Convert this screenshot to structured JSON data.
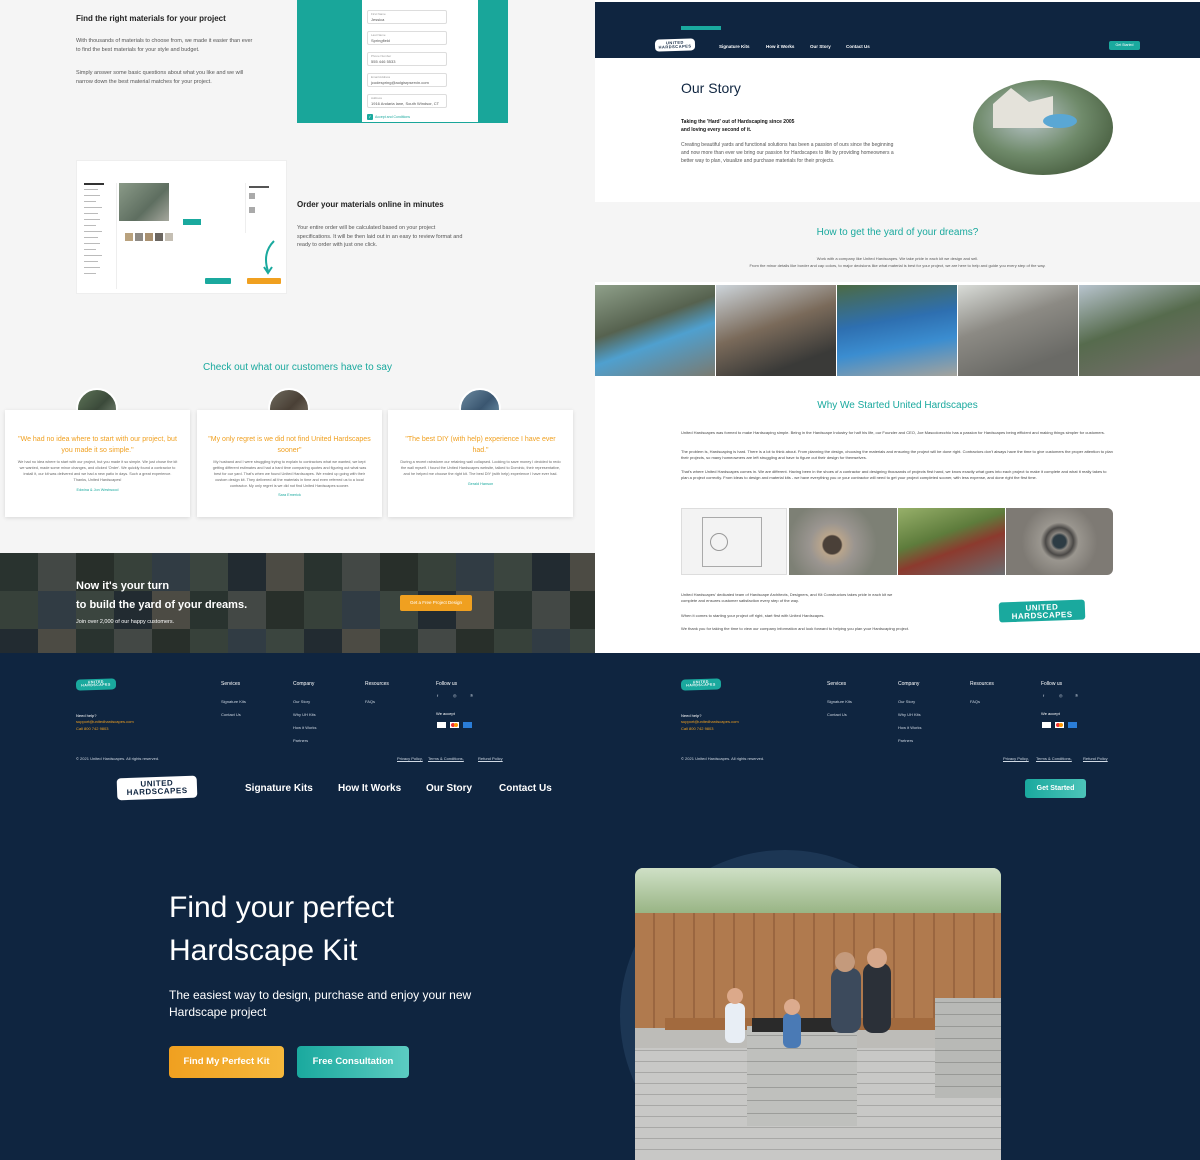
{
  "left": {
    "materials": {
      "title": "Find the right materials for your project",
      "p1": "With thousands of materials to choose from, we made it easier than ever to find the best materials for your style and budget.",
      "p2": "Simply answer some basic questions about what you like and we will narrow down the best material matches for your project."
    },
    "form": {
      "fields": [
        {
          "label": "First Name",
          "value": "Jessica"
        },
        {
          "label": "Last Name",
          "value": "Springfield"
        },
        {
          "label": "Phone Number",
          "value": "555 446 5533"
        },
        {
          "label": "Email Address",
          "value": "jcodespring@aolgisrpservin.com"
        },
        {
          "label": "Address",
          "value": "1916 Andaria lane, South Windsor, CT"
        }
      ],
      "accept": "Accept and Conditions"
    },
    "order": {
      "title": "Order your materials online in minutes",
      "p": "Your entire order will be calculated based on your project specifications. It will be then laid out in an easy to review format and ready to order with just one click."
    },
    "testimonials_title": "Check out what our customers have to say",
    "testimonials": [
      {
        "quote": "\"We had no idea where to start with our project, but you made it so simple.\"",
        "body": "We had no idea where to start with our project, but you made it so simple. We just chose the kit we wanted, made some minor changes, and clicked 'Order'. We quickly found a contractor to install it, our kit was delivered and we had a new patio in days. Such a great experience. Thanks, United Hardscapes!",
        "author": "Edwina & Jon Westwood"
      },
      {
        "quote": "\"My only regret is we did not find United Hardscapes sooner\"",
        "body": "My husband and I were struggling trying to explain to contractors what we wanted, we kept getting different estimates and had a hard time comparing quotes and figuring out what was best for our yard. That's when we found United Hardscapes. We ended up going with their custom design kit. They delivered all the materials in time and even referred us to a local contractor. My only regret is we did not find United Hardscapes sooner.",
        "author": "Sara Emerick"
      },
      {
        "quote": "\"The best DIY (with help) experience I have ever had.\"",
        "body": "During a recent rainstorm our retaining wall collapsed. Looking to save money I decided to redo the wall myself. I found the United Hardscapes website, talked to Dominic, their representative, and he helped me choose the right kit. The best DIY (with help) experience I have ever had.",
        "author": "Gerald Hanson"
      }
    ],
    "cta": {
      "line1": "Now it's your turn",
      "line2": "to build the yard of your dreams.",
      "sub": "Join over 2,000 of our happy customers.",
      "button": "Get a Free Project Design"
    }
  },
  "right": {
    "nav": {
      "links": [
        "Signature Kits",
        "How it Works",
        "Our Story",
        "Contact Us"
      ],
      "cta": "Get Started"
    },
    "story": {
      "title": "Our Story",
      "lead1": "Taking the 'Hard' out of Hardscaping since 2005",
      "lead2": "and loving every second of it.",
      "p": "Creating beautiful yards and functional solutions has been a passion of ours since the beginning and now more than ever we bring our passion for Hardscapes to life by providing homeowners a better way to plan, visualize and purchase materials for their projects."
    },
    "dreams": {
      "title": "How to get the yard of your dreams?",
      "p1": "Work with a company like United Hardscapes. We take pride in each kit we design and sell.",
      "p2": "From the minor details like border and cap colors, to major decisions like what material is best for your project, we are here to help and guide you every step of the way."
    },
    "why": {
      "title": "Why We Started United Hardscapes",
      "p1": "United Hardscapes was formed to make Hardscaping simple. Being in the Hardscape Industry for half his life, our Founder and CEO, Joe Mascoloecchio has a passion for Hardscapes being efficient and making things simpler for customers.",
      "p2": "The problem is, Hardscaping is hard. There is a lot to think about. From planning the design, choosing the materials and ensuring the project will be done right. Contractors don't always have the time to give customers the proper attention to plan their projects, so many homeowners are left struggling and have to figure out their design for themselves.",
      "p3": "That's where United Hardscapes comes in. We are different. Having been in the shoes of a contractor and designing thousands of projects first hand, we know exactly what goes into each project to make it complete and what it really takes to plan a project correctly. From ideas to design and material kits - we have everything you or your contractor will need to get your project completed sooner, with less expense, and done right the first time.",
      "p4": "United Hardscapes' dedicated team of Hardscape Architects, Designers, and Kit Constructors takes pride in each kit we complete and ensures customer satisfaction every step of the way.",
      "p5": "When it comes to starting your project off right, start first with United Hardscapes.",
      "p6": "We thank you for taking the time to view our company information and look forward to helping you plan your Hardscaping project."
    }
  },
  "logo": {
    "line1": "UNITED",
    "line2": "HARDSCAPES"
  },
  "footer": {
    "need_help": "Need help?",
    "email": "support@unitedhardscapes.com",
    "phone": "Call 800 742 9803",
    "copyright": "© 2021 United Hardscapes. All rights reserved.",
    "cols": {
      "services": {
        "title": "Services",
        "items": [
          "Signature Kits",
          "Contact Us"
        ]
      },
      "company": {
        "title": "Company",
        "items": [
          "Our Story",
          "Why UH Kits",
          "How it Works",
          "Partners"
        ]
      },
      "resources": {
        "title": "Resources",
        "items": [
          "FAQs"
        ]
      },
      "follow": {
        "title": "Follow us",
        "accept": "We accept"
      }
    },
    "legal": [
      "Privacy Policy,",
      "Terms & Conditions,",
      "Refund Policy"
    ]
  },
  "hero": {
    "nav": [
      "Signature Kits",
      "How It Works",
      "Our Story",
      "Contact Us"
    ],
    "nav_cta": "Get Started",
    "title1": "Find your perfect",
    "title2": "Hardscape Kit",
    "sub": "The easiest way to design, purchase and enjoy your new Hardscape project",
    "btn1": "Find My Perfect Kit",
    "btn2": "Free Consultation"
  },
  "colors": {
    "navy": "#0f2540",
    "teal": "#1aa99e",
    "orange": "#f0a020"
  },
  "icons": [
    "facebook-icon",
    "instagram-icon",
    "pinterest-icon",
    "visa-icon",
    "mastercard-icon",
    "amex-icon",
    "check-icon",
    "arrow-down-icon"
  ]
}
